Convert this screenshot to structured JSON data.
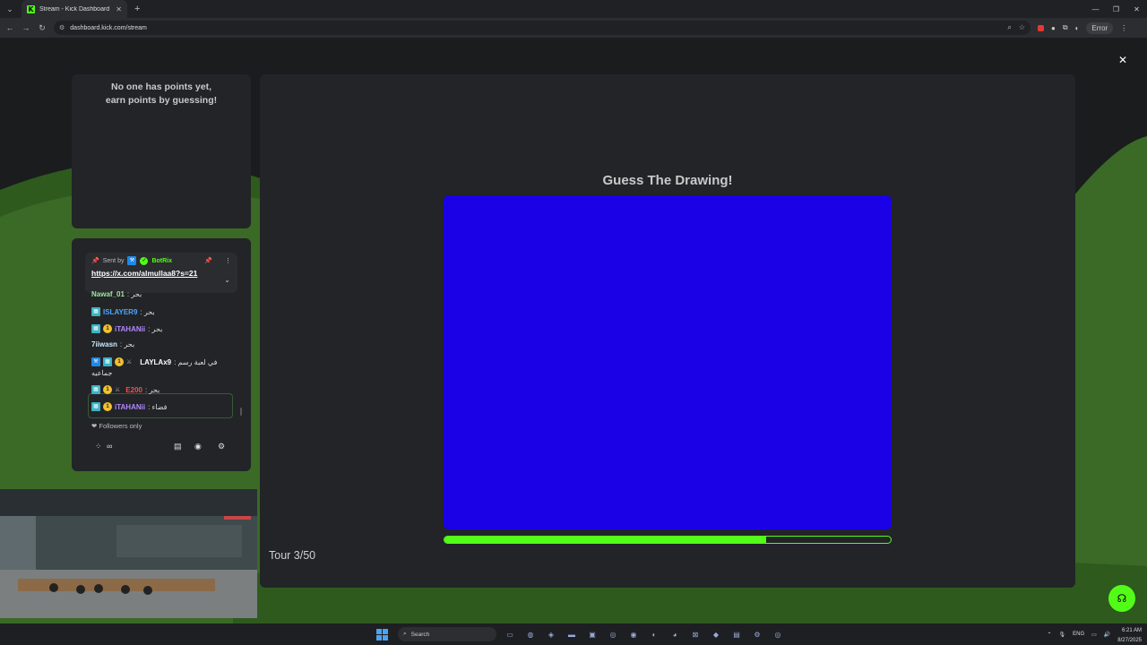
{
  "browser": {
    "tab_title": "Stream - Kick Dashboard",
    "tab_favicon": "K",
    "url": "dashboard.kick.com/stream",
    "error_label": "Error"
  },
  "leaderboard": {
    "line1": "No one has points yet,",
    "line2": "earn points by guessing!"
  },
  "pinned": {
    "sent_by": "Sent by",
    "sender": "BotRix",
    "link": "https://x.com/almullaa8?s=21"
  },
  "chat": {
    "messages": [
      {
        "name": "Nawaf_01",
        "name_color": "#9ee6a0",
        "body": ": بحر"
      },
      {
        "name": "ISLAYER9",
        "name_color": "#4da6ff",
        "body": ": بحر"
      },
      {
        "name": "iTAHANii",
        "name_color": "#b388ff",
        "body": ": بحر"
      },
      {
        "name": "7iiwasn",
        "name_color": "#cfe8ff",
        "body": ": بحر"
      },
      {
        "name": "LAYLAx9",
        "name_color": "#ffffff",
        "body": ": في لعبة رسم",
        "body2": "جماعيه"
      },
      {
        "name": "E200",
        "name_color": "#ff4d4d",
        "body": ": بحر"
      },
      {
        "name": "iTAHANii",
        "name_color": "#b388ff",
        "body": ": فضاء"
      }
    ],
    "followers_only": "Followers only"
  },
  "game": {
    "title": "Guess The Drawing!",
    "canvas_color": "#1a01e6",
    "progress_fraction": 0.72,
    "tour": "Tour 3/50"
  },
  "taskbar": {
    "search_placeholder": "Search",
    "lang": "ENG",
    "time": "6:21 AM",
    "date": "8/27/2025"
  },
  "colors": {
    "accent": "#53fc18",
    "panel": "#222427",
    "background": "#1a1c1e"
  }
}
